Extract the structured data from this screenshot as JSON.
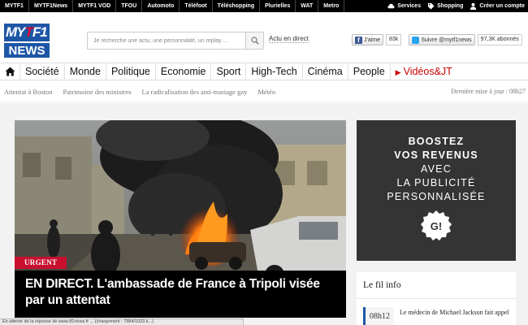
{
  "topbar": {
    "network": [
      "MYTF1",
      "MYTF1News",
      "MYTF1 VOD",
      "TFOU",
      "Automoto",
      "Téléfoot",
      "Téléshopping",
      "Plurielles",
      "WAT",
      "Metro"
    ],
    "services_label": "Services",
    "shopping_label": "Shopping",
    "account_label": "Créer un compte"
  },
  "header": {
    "logo_top_left": "MY",
    "logo_top_mid": "T",
    "logo_top_right": "F1",
    "logo_bottom": "NEWS",
    "search_placeholder": "Je recherche une actu, une personnalité, un replay ...",
    "live_link": "Actu en direct",
    "facebook_label": "J'aime",
    "facebook_count": "83k",
    "twitter_label": "Suivre @mytf1news",
    "twitter_count": "97,3K abonnés"
  },
  "nav": {
    "items": [
      "Société",
      "Monde",
      "Politique",
      "Economie",
      "Sport",
      "High-Tech",
      "Cinéma",
      "People"
    ],
    "video_label": "Vidéos&JT"
  },
  "subnav": {
    "tags": [
      "Attentat à Boston",
      "Patrimoine des ministres",
      "La radicalisation des anti-mariage gay",
      "Météo"
    ],
    "updated": "Dernière mise à jour : 08h27"
  },
  "hero": {
    "badge": "URGENT",
    "headline": "EN DIRECT. L'ambassade de France à Tripoli visée par un attentat"
  },
  "ad": {
    "lines": [
      "BOOSTEZ",
      "VOS REVENUS",
      "AVEC",
      "LA PUBLICITÉ",
      "PERSONNALISÉE"
    ],
    "seal_text": "G!"
  },
  "fil_info": {
    "title": "Le fil info",
    "first_time": "08h12",
    "first_text": "Le médecin de Michael Jackson fait appel"
  },
  "statusbar": {
    "text": "En attente de la réponse de www.tf1news.fr ... (chargement : 7984/1023 k...)"
  },
  "colors": {
    "brand_blue": "#1e56a6",
    "urgent_red": "#c8102e",
    "video_red": "#cc0000"
  }
}
